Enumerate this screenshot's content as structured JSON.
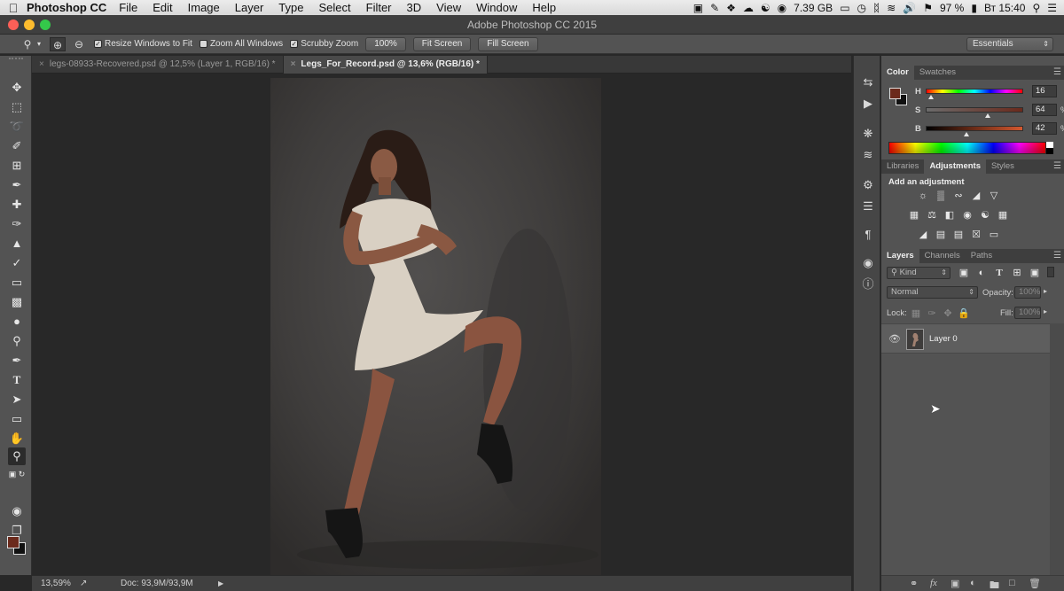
{
  "menubar": {
    "apple_icon": "apple-logo-icon",
    "app_name": "Photoshop CC",
    "items": [
      "File",
      "Edit",
      "Image",
      "Layer",
      "Type",
      "Select",
      "Filter",
      "3D",
      "View",
      "Window",
      "Help"
    ],
    "disk": "7.39 GB",
    "battery": "97 %",
    "clock": "Вт 15:40"
  },
  "window": {
    "title": "Adobe Photoshop CC 2015"
  },
  "options_bar": {
    "resize_windows": "Resize Windows to Fit",
    "zoom_all": "Zoom All Windows",
    "scrubby_zoom": "Scrubby Zoom",
    "btn_100": "100%",
    "btn_fit": "Fit Screen",
    "btn_fill": "Fill Screen",
    "workspace": "Essentials"
  },
  "tabs": [
    {
      "label": "legs-08933-Recovered.psd @ 12,5% (Layer 1, RGB/16) *",
      "active": false
    },
    {
      "label": "Legs_For_Record.psd @ 13,6% (RGB/16) *",
      "active": true
    }
  ],
  "status": {
    "zoom": "13,59%",
    "doc": "Doc: 93,9M/93,9M"
  },
  "color_panel": {
    "tabs": [
      "Color",
      "Swatches"
    ],
    "h_label": "H",
    "h_value": "16",
    "h_unit": "",
    "s_label": "S",
    "s_value": "64",
    "s_unit": "%",
    "b_label": "B",
    "b_value": "42",
    "b_unit": "%",
    "h_level": 0.04,
    "s_level": 0.64,
    "b_level": 0.42,
    "foreground": "#6b2a1c",
    "background": "#111111"
  },
  "adjustments_panel": {
    "tabs": [
      "Libraries",
      "Adjustments",
      "Styles"
    ],
    "heading": "Add an adjustment"
  },
  "layers_panel": {
    "tabs": [
      "Layers",
      "Channels",
      "Paths"
    ],
    "kind": "Kind",
    "blend_mode": "Normal",
    "opacity_label": "Opacity:",
    "opacity_value": "100%",
    "lock_label": "Lock:",
    "fill_label": "Fill:",
    "fill_value": "100%",
    "layers": [
      {
        "name": "Layer 0",
        "visible": true
      }
    ]
  }
}
